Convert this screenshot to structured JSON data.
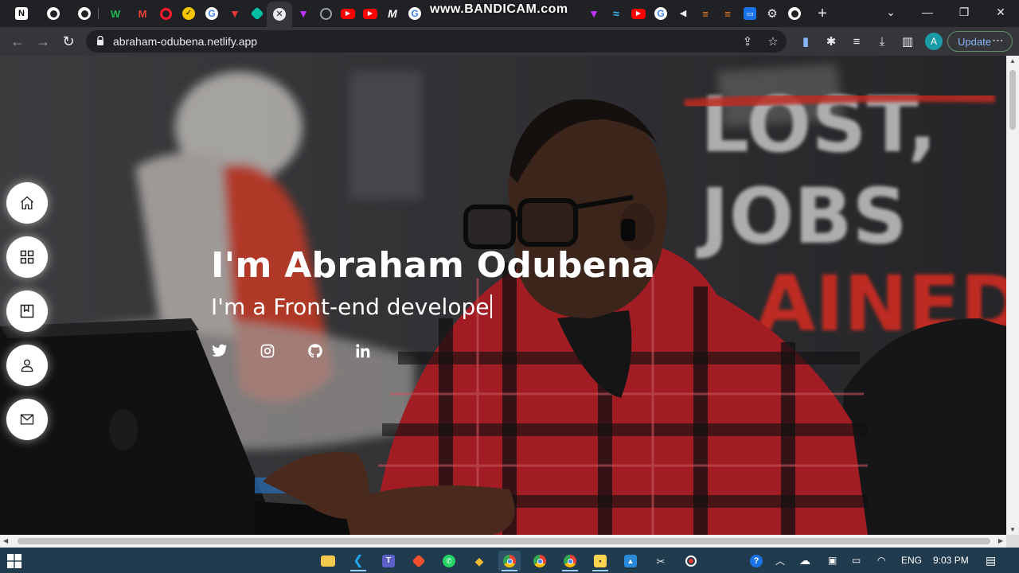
{
  "browser": {
    "watermark": "www.BANDICAM.com",
    "url": "abraham-odubena.netlify.app",
    "profile_initial": "A",
    "update_label": "Update",
    "tabs": [
      {
        "icon": "notion-icon",
        "color": "#ffffff"
      },
      {
        "icon": "globe-icon",
        "color": "#ffffff"
      },
      {
        "icon": "globe-icon",
        "color": "#ffffff"
      },
      {
        "icon": "wix-icon",
        "color": "#1db954"
      },
      {
        "icon": "gmail-icon",
        "color": "#ea4335"
      },
      {
        "icon": "opera-icon",
        "color": "#ff1b2d"
      },
      {
        "icon": "norton-icon",
        "color": "#f7c600"
      },
      {
        "icon": "google-icon",
        "color": "#4285f4"
      },
      {
        "icon": "vercel-icon",
        "color": "#e53935"
      },
      {
        "icon": "diamond-icon",
        "color": "#00bfa5"
      },
      {
        "icon": "close-icon",
        "color": "#e8eaed"
      },
      {
        "icon": "vite-icon",
        "color": "#bd34fe"
      },
      {
        "icon": "github-icon",
        "color": "#9aa0a6"
      },
      {
        "icon": "youtube-icon",
        "color": "#ff0000"
      },
      {
        "icon": "youtube-icon",
        "color": "#ff0000"
      },
      {
        "icon": "medium-icon",
        "color": "#ffffff"
      },
      {
        "icon": "google-icon",
        "color": "#4285f4"
      }
    ]
  },
  "hero": {
    "name": "I'm Abraham Odubena",
    "role": "I'm a Front-end develope"
  },
  "side_nav": [
    {
      "icon": "home-icon"
    },
    {
      "icon": "grid-icon"
    },
    {
      "icon": "portfolio-icon"
    },
    {
      "icon": "user-icon"
    },
    {
      "icon": "mail-icon"
    }
  ],
  "socials": [
    {
      "icon": "twitter-icon"
    },
    {
      "icon": "instagram-icon"
    },
    {
      "icon": "github-icon"
    },
    {
      "icon": "linkedin-icon"
    }
  ],
  "taskbar": {
    "language": "ENG",
    "time": "9:03 PM"
  },
  "colors": {
    "accent": "#8ab4f8",
    "taskbar": "#1f3b4d",
    "shirt_red": "#d8262e"
  }
}
